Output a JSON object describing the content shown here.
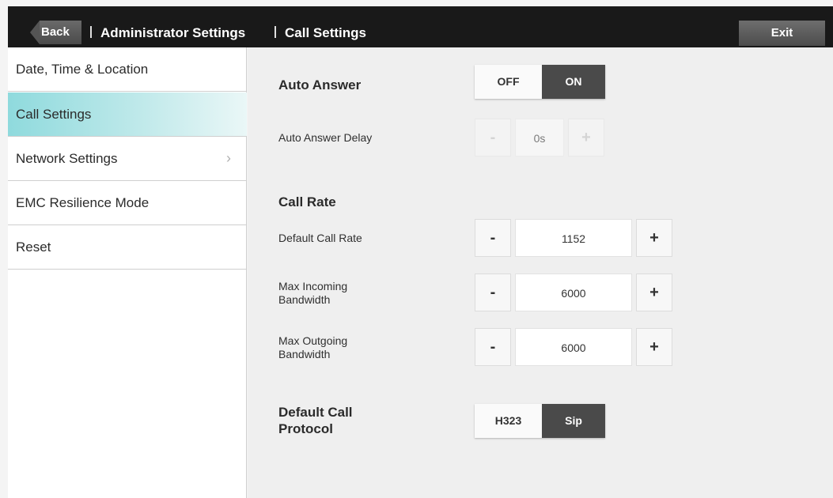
{
  "header": {
    "back_label": "Back",
    "crumbs": [
      "Administrator Settings",
      "Call Settings"
    ],
    "exit_label": "Exit"
  },
  "sidebar": {
    "items": [
      {
        "label": "Date, Time & Location",
        "active": false
      },
      {
        "label": "Call Settings",
        "active": true
      },
      {
        "label": "Network Settings",
        "active": false,
        "has_submenu": true
      },
      {
        "label": "EMC Resilience Mode",
        "active": false
      },
      {
        "label": "Reset",
        "active": false
      }
    ],
    "chevron": "›"
  },
  "main": {
    "auto_answer": {
      "label": "Auto Answer",
      "off": "OFF",
      "on": "ON",
      "value": "ON"
    },
    "auto_answer_delay": {
      "label": "Auto Answer Delay",
      "minus": "-",
      "value": "0s",
      "plus": "+",
      "disabled": true
    },
    "call_rate": {
      "title": "Call Rate"
    },
    "default_call_rate": {
      "label": "Default Call Rate",
      "minus": "-",
      "value": "1152",
      "plus": "+"
    },
    "max_incoming": {
      "label_line1": "Max Incoming",
      "label_line2": "Bandwidth",
      "minus": "-",
      "value": "6000",
      "plus": "+"
    },
    "max_outgoing": {
      "label_line1": "Max Outgoing",
      "label_line2": "Bandwidth",
      "minus": "-",
      "value": "6000",
      "plus": "+"
    },
    "protocol": {
      "label_line1": "Default Call",
      "label_line2": "Protocol",
      "opt1": "H323",
      "opt2": "Sip",
      "value": "Sip"
    }
  },
  "colors": {
    "active_item": "#8fdadd",
    "topbar": "#191919",
    "selected_segment": "#4a4a4a"
  }
}
